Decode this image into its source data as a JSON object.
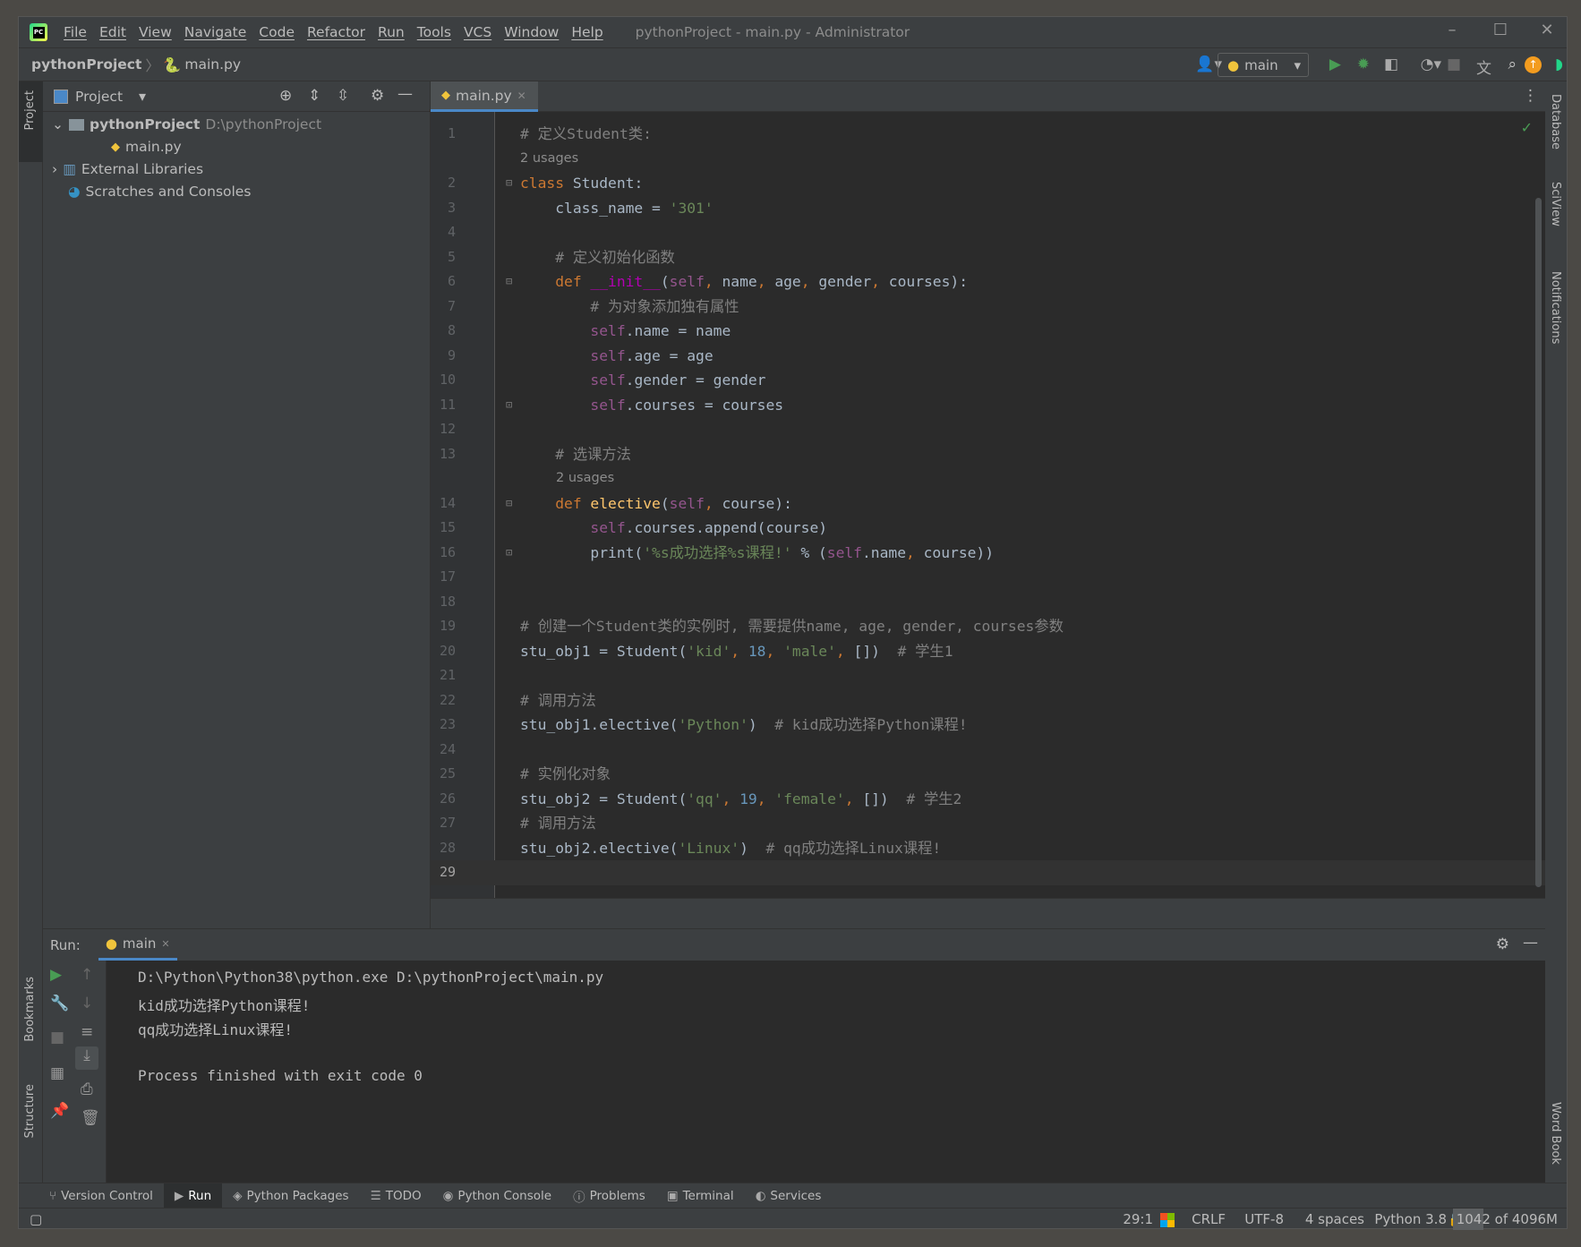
{
  "window": {
    "title": "pythonProject - main.py - Administrator",
    "menu": [
      "File",
      "Edit",
      "View",
      "Navigate",
      "Code",
      "Refactor",
      "Run",
      "Tools",
      "VCS",
      "Window",
      "Help"
    ]
  },
  "breadcrumb": {
    "project": "pythonProject",
    "file": "main.py"
  },
  "toolbar": {
    "run_config": "main"
  },
  "project_panel": {
    "title": "Project",
    "root": "pythonProject",
    "root_path": "D:\\pythonProject",
    "file": "main.py",
    "external": "External Libraries",
    "scratches": "Scratches and Consoles"
  },
  "editor": {
    "tab": "main.py",
    "lines": [
      {
        "n": "1",
        "tokens": [
          [
            "# 定义Student类:",
            "cm"
          ]
        ]
      },
      {
        "inlay": "2 usages",
        "indent": 0
      },
      {
        "n": "2",
        "tokens": [
          [
            "class ",
            "kw"
          ],
          [
            "Student:",
            "p"
          ]
        ]
      },
      {
        "n": "3",
        "tokens": [
          [
            "    class_name = ",
            "p"
          ],
          [
            "'301'",
            "str"
          ]
        ]
      },
      {
        "n": "4",
        "tokens": []
      },
      {
        "n": "5",
        "tokens": [
          [
            "    # 定义初始化函数",
            "cm"
          ]
        ]
      },
      {
        "n": "6",
        "tokens": [
          [
            "    def ",
            "kw"
          ],
          [
            "__init__",
            "magic"
          ],
          [
            "(",
            "p"
          ],
          [
            "self",
            "self"
          ],
          [
            ", ",
            "kw"
          ],
          [
            "name",
            "p"
          ],
          [
            ", ",
            "kw"
          ],
          [
            "age",
            "p"
          ],
          [
            ", ",
            "kw"
          ],
          [
            "gender",
            "p"
          ],
          [
            ", ",
            "kw"
          ],
          [
            "courses):",
            "p"
          ]
        ]
      },
      {
        "n": "7",
        "tokens": [
          [
            "        # 为对象添加独有属性",
            "cm"
          ]
        ]
      },
      {
        "n": "8",
        "tokens": [
          [
            "        self",
            "self"
          ],
          [
            ".name = name",
            "p"
          ]
        ]
      },
      {
        "n": "9",
        "tokens": [
          [
            "        self",
            "self"
          ],
          [
            ".age = age",
            "p"
          ]
        ]
      },
      {
        "n": "10",
        "tokens": [
          [
            "        self",
            "self"
          ],
          [
            ".gender = gender",
            "p"
          ]
        ]
      },
      {
        "n": "11",
        "tokens": [
          [
            "        self",
            "self"
          ],
          [
            ".courses = courses",
            "p"
          ]
        ]
      },
      {
        "n": "12",
        "tokens": []
      },
      {
        "n": "13",
        "tokens": [
          [
            "    # 选课方法",
            "cm"
          ]
        ]
      },
      {
        "inlay": "2 usages",
        "indent": 1
      },
      {
        "n": "14",
        "tokens": [
          [
            "    def ",
            "kw"
          ],
          [
            "elective",
            "fn"
          ],
          [
            "(",
            "p"
          ],
          [
            "self",
            "self"
          ],
          [
            ", ",
            "kw"
          ],
          [
            "course):",
            "p"
          ]
        ]
      },
      {
        "n": "15",
        "tokens": [
          [
            "        self",
            "self"
          ],
          [
            ".courses.append(course)",
            "p"
          ]
        ]
      },
      {
        "n": "16",
        "tokens": [
          [
            "        print(",
            "p"
          ],
          [
            "'%s成功选择%s课程!'",
            "str"
          ],
          [
            " % (",
            "p"
          ],
          [
            "self",
            "self"
          ],
          [
            ".name",
            "p"
          ],
          [
            ", ",
            "kw"
          ],
          [
            "course))",
            "p"
          ]
        ]
      },
      {
        "n": "17",
        "tokens": []
      },
      {
        "n": "18",
        "tokens": []
      },
      {
        "n": "19",
        "tokens": [
          [
            "# 创建一个Student类的实例时, 需要提供name, age, gender, courses参数",
            "cm"
          ]
        ]
      },
      {
        "n": "20",
        "tokens": [
          [
            "stu_obj1 = Student(",
            "p"
          ],
          [
            "'kid'",
            "str"
          ],
          [
            ", ",
            "kw"
          ],
          [
            "18",
            "num"
          ],
          [
            ", ",
            "kw"
          ],
          [
            "'male'",
            "str"
          ],
          [
            ", ",
            "kw"
          ],
          [
            "[])  ",
            "p"
          ],
          [
            "# 学生1",
            "cm"
          ]
        ]
      },
      {
        "n": "21",
        "tokens": []
      },
      {
        "n": "22",
        "tokens": [
          [
            "# 调用方法",
            "cm"
          ]
        ]
      },
      {
        "n": "23",
        "tokens": [
          [
            "stu_obj1.elective(",
            "p"
          ],
          [
            "'Python'",
            "str"
          ],
          [
            ")  ",
            "p"
          ],
          [
            "# kid成功选择Python课程!",
            "cm"
          ]
        ]
      },
      {
        "n": "24",
        "tokens": []
      },
      {
        "n": "25",
        "tokens": [
          [
            "# 实例化对象",
            "cm"
          ]
        ]
      },
      {
        "n": "26",
        "tokens": [
          [
            "stu_obj2 = Student(",
            "p"
          ],
          [
            "'qq'",
            "str"
          ],
          [
            ", ",
            "kw"
          ],
          [
            "19",
            "num"
          ],
          [
            ", ",
            "kw"
          ],
          [
            "'female'",
            "str"
          ],
          [
            ", ",
            "kw"
          ],
          [
            "[])  ",
            "p"
          ],
          [
            "# 学生2",
            "cm"
          ]
        ]
      },
      {
        "n": "27",
        "tokens": [
          [
            "# 调用方法",
            "cm"
          ]
        ]
      },
      {
        "n": "28",
        "tokens": [
          [
            "stu_obj2.elective(",
            "p"
          ],
          [
            "'Linux'",
            "str"
          ],
          [
            ")  ",
            "p"
          ],
          [
            "# qq成功选择Linux课程!",
            "cm"
          ]
        ]
      },
      {
        "n": "29",
        "tokens": [],
        "current": true
      }
    ]
  },
  "run": {
    "label": "Run:",
    "tab": "main",
    "output": [
      "D:\\Python\\Python38\\python.exe D:\\pythonProject\\main.py",
      "kid成功选择Python课程!",
      "qq成功选择Linux课程!",
      "",
      "Process finished with exit code 0"
    ]
  },
  "side": {
    "left_top": "Project",
    "left_bookmarks": "Bookmarks",
    "left_structure": "Structure",
    "right": [
      "Database",
      "SciView",
      "Notifications"
    ],
    "right_bottom": "Word Book"
  },
  "bottom_tabs": [
    "Version Control",
    "Run",
    "Python Packages",
    "TODO",
    "Python Console",
    "Problems",
    "Terminal",
    "Services"
  ],
  "bottom_active": "Run",
  "status": {
    "position": "29:1",
    "line_sep": "CRLF",
    "encoding": "UTF-8",
    "indent": "4 spaces",
    "interpreter": "Python 3.8",
    "memory": "1042 of 4096M"
  },
  "colors": {
    "accent": "#4a88c7",
    "run_green": "#499c54",
    "keyword": "#cc7832",
    "string": "#6a8759",
    "comment": "#808080"
  }
}
